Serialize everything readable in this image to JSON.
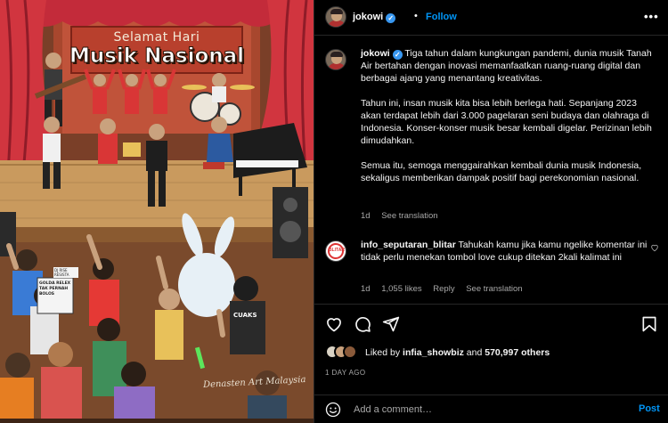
{
  "image": {
    "title_small": "Selamat Hari",
    "title_big": "Musik Nasional",
    "signature": "Denasten Art Malaysia",
    "shirt_text": "CUAKS",
    "sign_text": "GOLDA RELEX TAK PERNAH BOLOS",
    "sign_text2": "DJ RISE RESISTA"
  },
  "header": {
    "username": "jokowi",
    "separator": "•",
    "follow_label": "Follow",
    "more_label": "•••"
  },
  "caption": {
    "username": "jokowi",
    "paragraph1": "Tiga tahun dalam kungkungan pandemi, dunia musik Tanah Air bertahan dengan inovasi memanfaatkan ruang-ruang digital dan berbagai ajang yang menantang kreativitas.",
    "paragraph2": "Tahun ini, insan musik kita bisa lebih berlega hati. Sepanjang 2023 akan terdapat lebih dari 3.000 pagelaran seni budaya dan olahraga di Indonesia. Konser-konser musik besar kembali digelar. Perizinan lebih dimudahkan.",
    "paragraph3": "Semua itu, semoga menggairahkan kembali dunia musik Indonesia, sekaligus memberikan dampak positif bagi perekonomian nasional.",
    "age": "1d",
    "see_translation": "See translation"
  },
  "comment": {
    "username": "info_seputaran_blitar",
    "text": "Tahukah kamu jika kamu ngelike komentar ini tidak perlu menekan tombol love cukup ditekan 2kali kalimat ini",
    "age": "1d",
    "likes": "1,055 likes",
    "reply": "Reply",
    "see_translation": "See translation",
    "avatar_text": "BLITAR"
  },
  "actions": {
    "liked_by_prefix": "Liked by",
    "liked_by_user": "infia_showbiz",
    "and_label": "and",
    "others_count": "570,997 others",
    "date": "1 DAY AGO"
  },
  "add_comment": {
    "placeholder": "Add a comment…",
    "post_label": "Post"
  },
  "colors": {
    "link_blue": "#0095f6",
    "verified_blue": "#3897f0",
    "secondary_text": "#a8a8a8",
    "divider": "#262626"
  },
  "icons": [
    "heart-icon",
    "comment-icon",
    "share-icon",
    "bookmark-icon",
    "emoji-icon",
    "verified-icon",
    "more-icon"
  ]
}
